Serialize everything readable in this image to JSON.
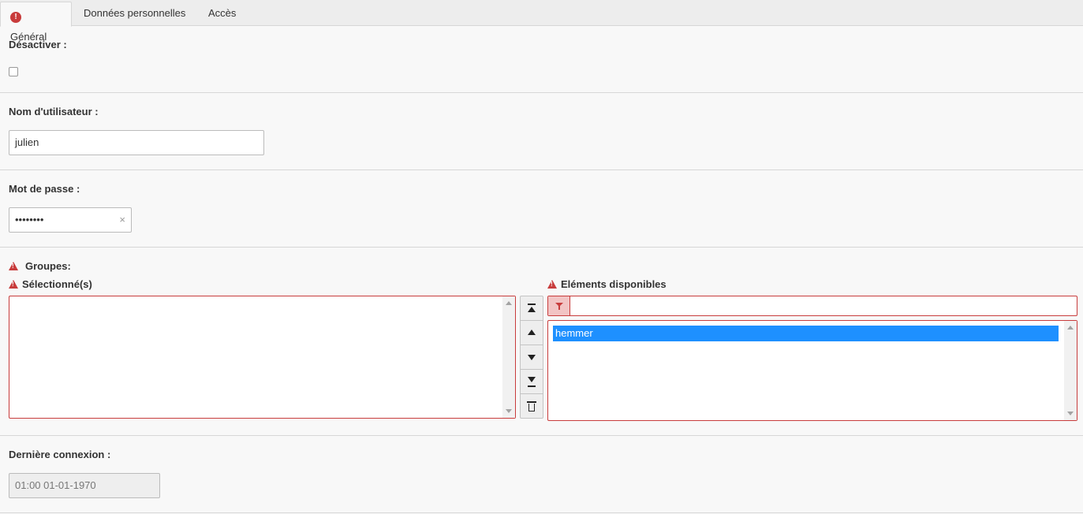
{
  "tabs": [
    {
      "label": "Général",
      "active": true,
      "has_error": true
    },
    {
      "label": "Données personnelles",
      "active": false
    },
    {
      "label": "Accès",
      "active": false
    }
  ],
  "disable": {
    "label": "Désactiver :",
    "checked": false
  },
  "username": {
    "label": "Nom d'utilisateur :",
    "value": "julien"
  },
  "password": {
    "label": "Mot de passe :",
    "value": "••••••••",
    "clear_icon": "×"
  },
  "groups": {
    "label": "Groupes:",
    "selected_label": "Sélectionné(s)",
    "selected_items": [],
    "available_label": "Eléments disponibles",
    "filter_value": "",
    "available_items": [
      "hemmer"
    ],
    "highlighted_item": "hemmer",
    "controls": [
      "move-top-icon",
      "move-up-icon",
      "move-down-icon",
      "move-bottom-icon",
      "trash-icon"
    ]
  },
  "last_login": {
    "label": "Dernière connexion :",
    "value": "01:00 01-01-1970"
  },
  "colors": {
    "error": "#c83c3c",
    "selection": "#1e90ff",
    "background": "#f8f8f8"
  }
}
